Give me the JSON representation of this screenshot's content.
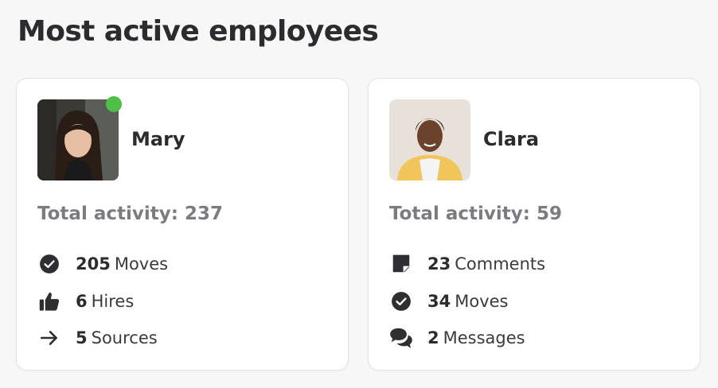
{
  "page": {
    "title": "Most active employees"
  },
  "employees": [
    {
      "name": "Mary",
      "online": true,
      "total_label": "Total activity: 237",
      "stats": [
        {
          "icon": "check-circle-icon",
          "count": "205",
          "label": "Moves"
        },
        {
          "icon": "thumbs-up-icon",
          "count": "6",
          "label": "Hires"
        },
        {
          "icon": "arrow-right-icon",
          "count": "5",
          "label": "Sources"
        }
      ]
    },
    {
      "name": "Clara",
      "online": false,
      "total_label": "Total activity: 59",
      "stats": [
        {
          "icon": "note-icon",
          "count": "23",
          "label": "Comments"
        },
        {
          "icon": "check-circle-icon",
          "count": "34",
          "label": "Moves"
        },
        {
          "icon": "chat-bubbles-icon",
          "count": "2",
          "label": "Messages"
        }
      ]
    }
  ],
  "colors": {
    "online": "#4fbf47",
    "muted_text": "#7b7b82",
    "icon": "#2f2f33"
  }
}
